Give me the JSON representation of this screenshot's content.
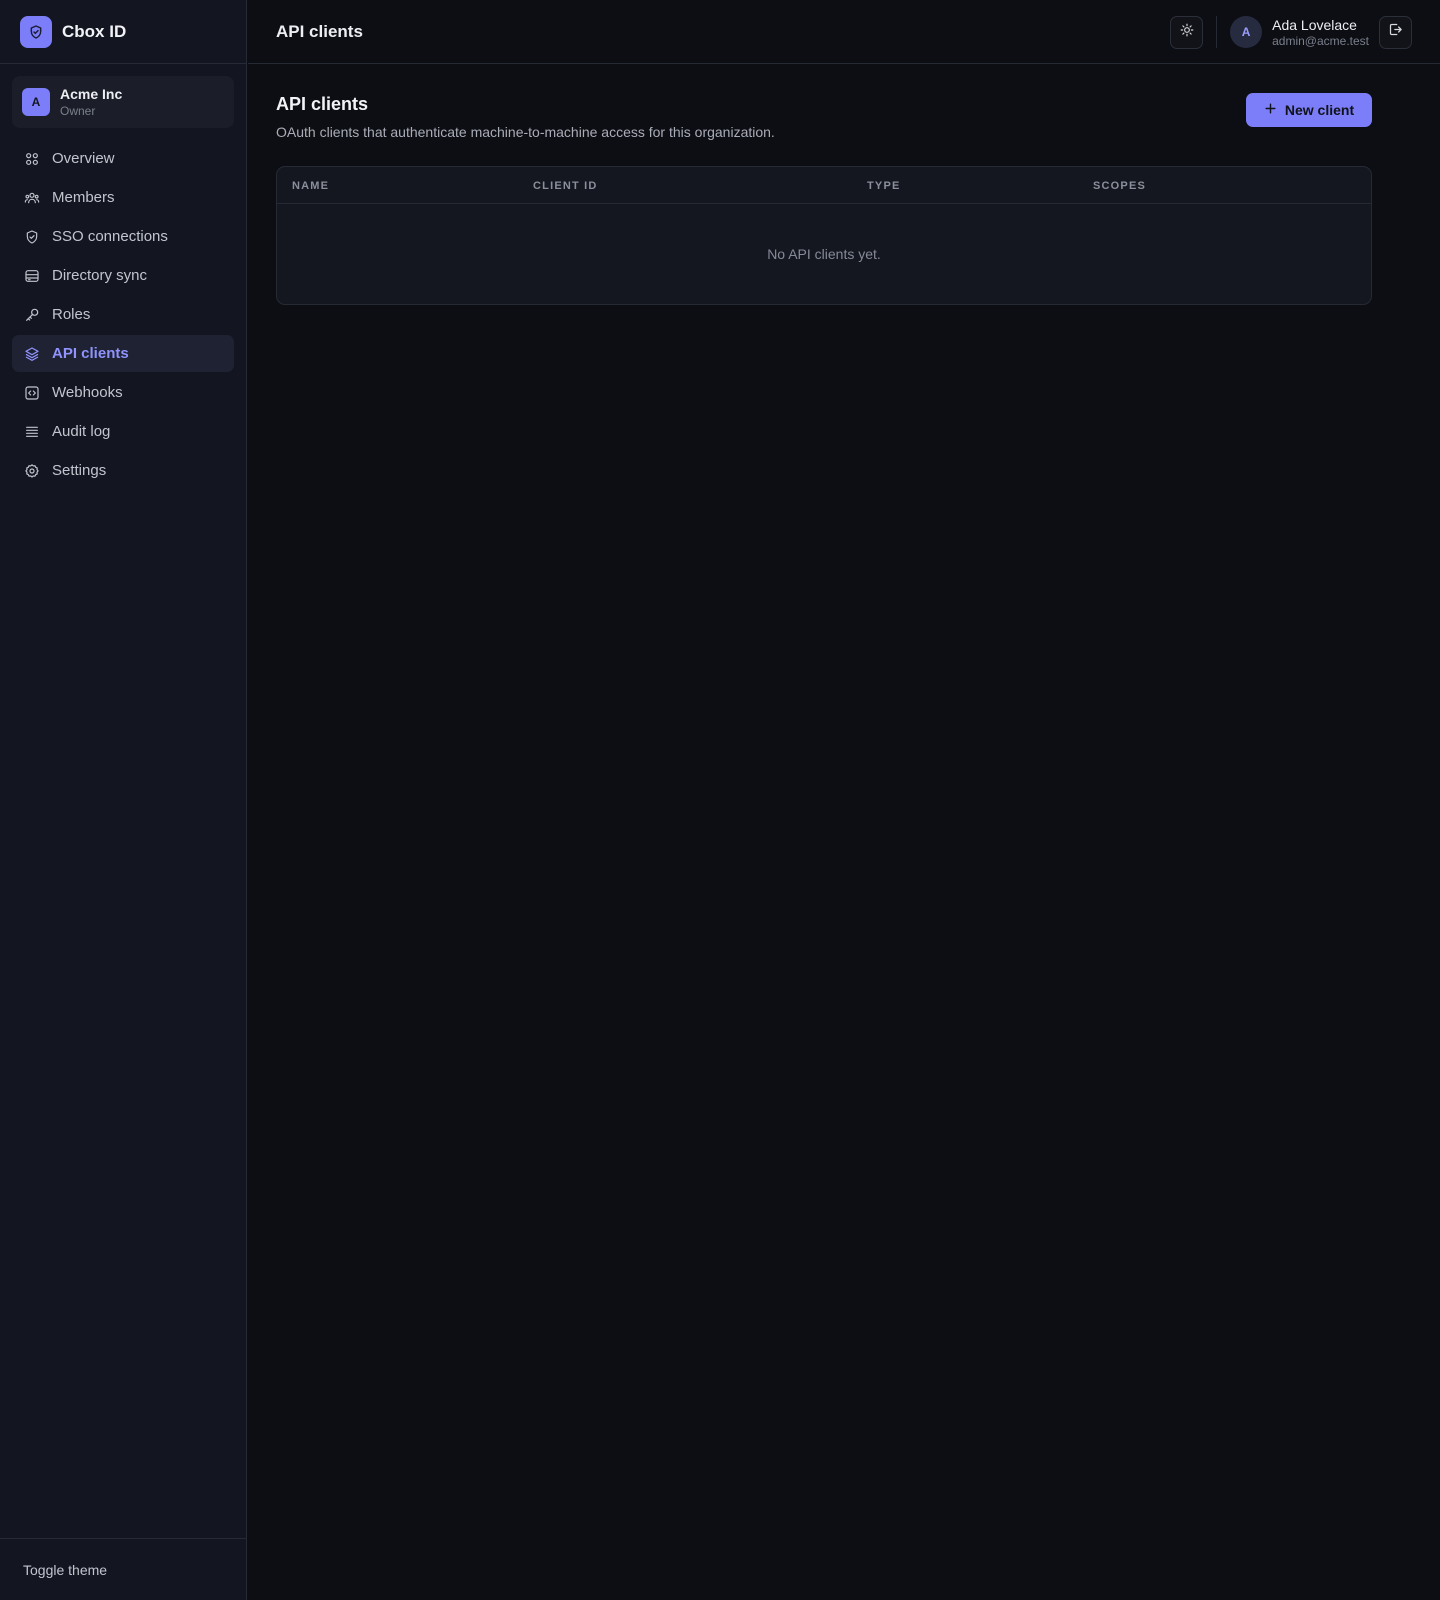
{
  "app": {
    "name": "Cbox ID"
  },
  "organization": {
    "initial": "A",
    "name": "Acme Inc",
    "role": "Owner"
  },
  "sidebar": {
    "items": [
      {
        "label": "Overview",
        "icon": "grid-icon"
      },
      {
        "label": "Members",
        "icon": "users-icon"
      },
      {
        "label": "SSO connections",
        "icon": "shield-check-icon"
      },
      {
        "label": "Directory sync",
        "icon": "database-icon"
      },
      {
        "label": "Roles",
        "icon": "key-icon"
      },
      {
        "label": "API clients",
        "icon": "layers-icon",
        "active": true
      },
      {
        "label": "Webhooks",
        "icon": "code-square-icon"
      },
      {
        "label": "Audit log",
        "icon": "list-icon"
      },
      {
        "label": "Settings",
        "icon": "gear-icon"
      }
    ],
    "footer_label": "Toggle theme"
  },
  "topbar": {
    "title": "API clients"
  },
  "user": {
    "initial": "A",
    "name": "Ada Lovelace",
    "email": "admin@acme.test"
  },
  "page": {
    "title": "API clients",
    "subtitle": "OAuth clients that authenticate machine-to-machine access for this organization.",
    "new_button_label": "New client"
  },
  "table": {
    "columns": [
      "NAME",
      "CLIENT ID",
      "TYPE",
      "SCOPES"
    ],
    "rows": [],
    "empty_text": "No API clients yet."
  },
  "colors": {
    "accent": "#7b7ef8",
    "background": "#0d0e13",
    "sidebar": "#131620",
    "active_text": "#8f93fb"
  }
}
